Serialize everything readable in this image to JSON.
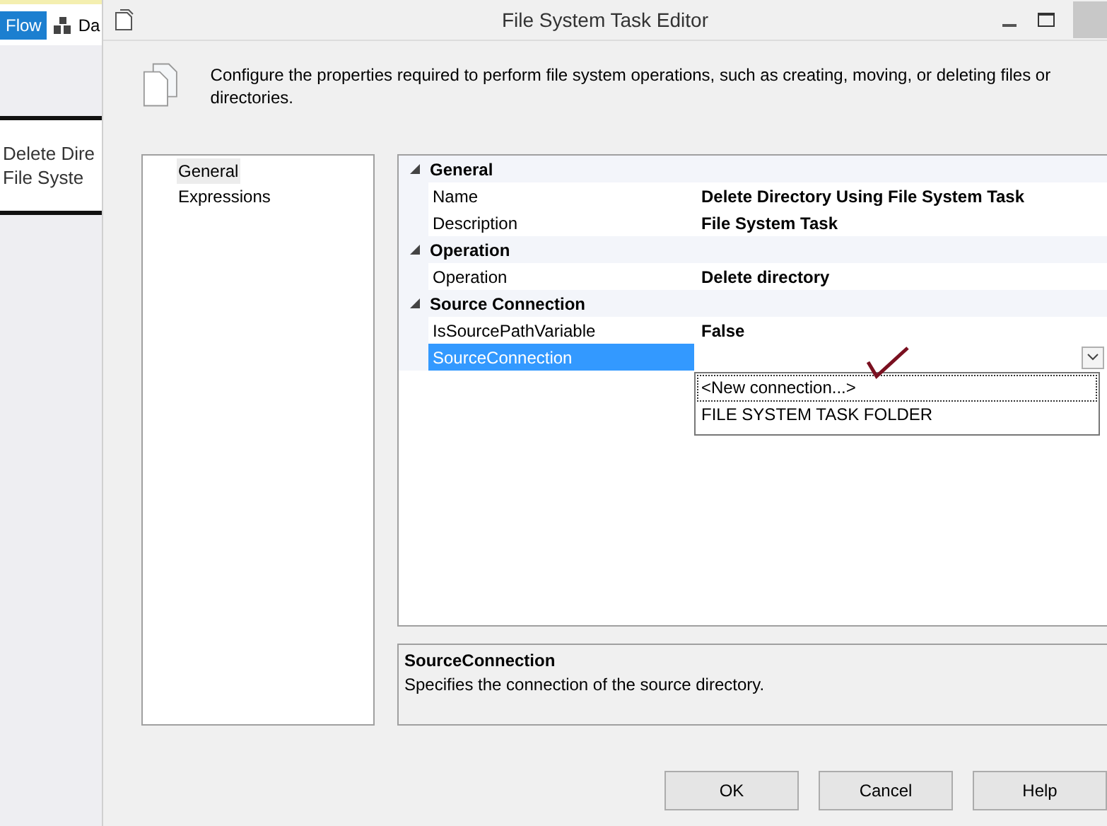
{
  "background": {
    "tab": "Flow",
    "toolbar_item": "Da",
    "task_box_lines": [
      "Delete Dire",
      "File Syste"
    ]
  },
  "window": {
    "title": "File System Task Editor"
  },
  "header": {
    "description": "Configure the properties required to perform file system operations, such as creating, moving, or deleting files or directories."
  },
  "pages": [
    {
      "label": "General",
      "selected": true
    },
    {
      "label": "Expressions",
      "selected": false
    }
  ],
  "properties": [
    {
      "category": "General",
      "expanded": true,
      "rows": [
        {
          "name": "Name",
          "value": "Delete Directory Using File System Task",
          "selected": false
        },
        {
          "name": "Description",
          "value": "File System Task",
          "selected": false
        }
      ]
    },
    {
      "category": "Operation",
      "expanded": true,
      "rows": [
        {
          "name": "Operation",
          "value": "Delete directory",
          "selected": false
        }
      ]
    },
    {
      "category": "Source Connection",
      "expanded": true,
      "rows": [
        {
          "name": "IsSourcePathVariable",
          "value": "False",
          "selected": false
        },
        {
          "name": "SourceConnection",
          "selected": true
        }
      ]
    }
  ],
  "dropdown": {
    "items": [
      {
        "label": "<New connection...>",
        "focused": true
      },
      {
        "label": "FILE SYSTEM TASK FOLDER",
        "focused": false
      }
    ]
  },
  "help": {
    "title": "SourceConnection",
    "text": "Specifies the connection of the source directory."
  },
  "buttons": [
    "OK",
    "Cancel",
    "Help"
  ]
}
